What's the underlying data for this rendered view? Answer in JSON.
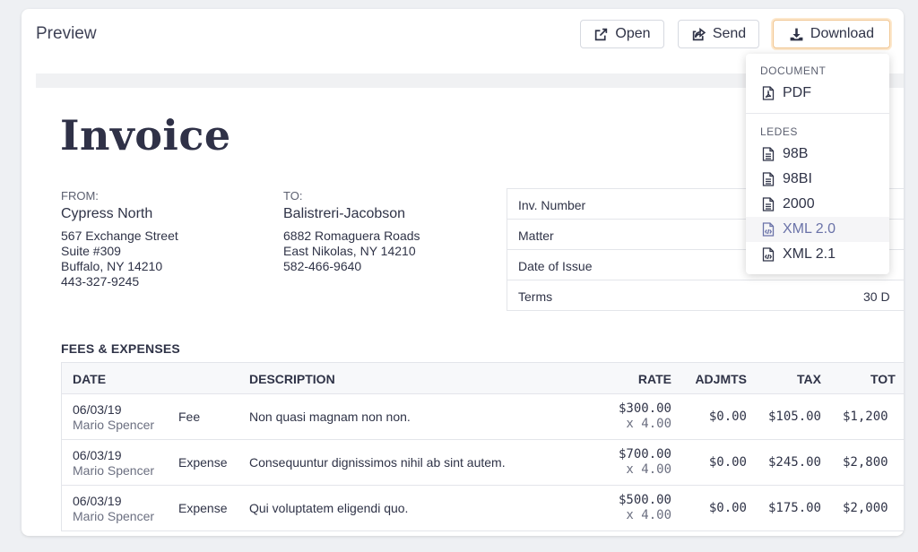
{
  "header": {
    "title": "Preview",
    "open_label": "Open",
    "send_label": "Send",
    "download_label": "Download"
  },
  "invoice": {
    "title": "Invoice",
    "from": {
      "label": "FROM:",
      "name": "Cypress North",
      "lines": [
        "567 Exchange Street",
        "Suite #309",
        "Buffalo, NY 14210",
        "443-327-9245"
      ]
    },
    "to": {
      "label": "TO:",
      "name": "Balistreri-Jacobson",
      "lines": [
        "6882 Romaguera Roads",
        "East Nikolas, NY 14210",
        "582-466-9640"
      ]
    },
    "meta": [
      {
        "key": "Inv. Number",
        "value": ""
      },
      {
        "key": "Matter",
        "value": ""
      },
      {
        "key": "Date of Issue",
        "value": ""
      },
      {
        "key": "Terms",
        "value": "30 D"
      }
    ]
  },
  "fees": {
    "title": "FEES & EXPENSES",
    "columns": [
      "DATE",
      "DESCRIPTION",
      "RATE",
      "ADJMTS",
      "TAX",
      "TOT"
    ],
    "rows": [
      {
        "date": "06/03/19",
        "person": "Mario Spencer",
        "type": "Fee",
        "desc": "Non quasi magnam non non.",
        "rate": "$300.00",
        "qty": "x 4.00",
        "adj": "$0.00",
        "tax": "$105.00",
        "total": "$1,200"
      },
      {
        "date": "06/03/19",
        "person": "Mario Spencer",
        "type": "Expense",
        "desc": "Consequuntur dignissimos nihil ab sint autem.",
        "rate": "$700.00",
        "qty": "x 4.00",
        "adj": "$0.00",
        "tax": "$245.00",
        "total": "$2,800"
      },
      {
        "date": "06/03/19",
        "person": "Mario Spencer",
        "type": "Expense",
        "desc": "Qui voluptatem eligendi quo.",
        "rate": "$500.00",
        "qty": "x 4.00",
        "adj": "$0.00",
        "tax": "$175.00",
        "total": "$2,000"
      }
    ]
  },
  "download_menu": {
    "document_section": "DOCUMENT",
    "document_items": [
      "PDF"
    ],
    "ledes_section": "LEDES",
    "ledes_items": [
      "98B",
      "98BI",
      "2000",
      "XML 2.0",
      "XML 2.1"
    ],
    "active_item": "XML 2.0"
  },
  "colors": {
    "download_border": "#f1c590",
    "menu_active_text": "#6a72a8",
    "title_text": "#2f3147"
  }
}
